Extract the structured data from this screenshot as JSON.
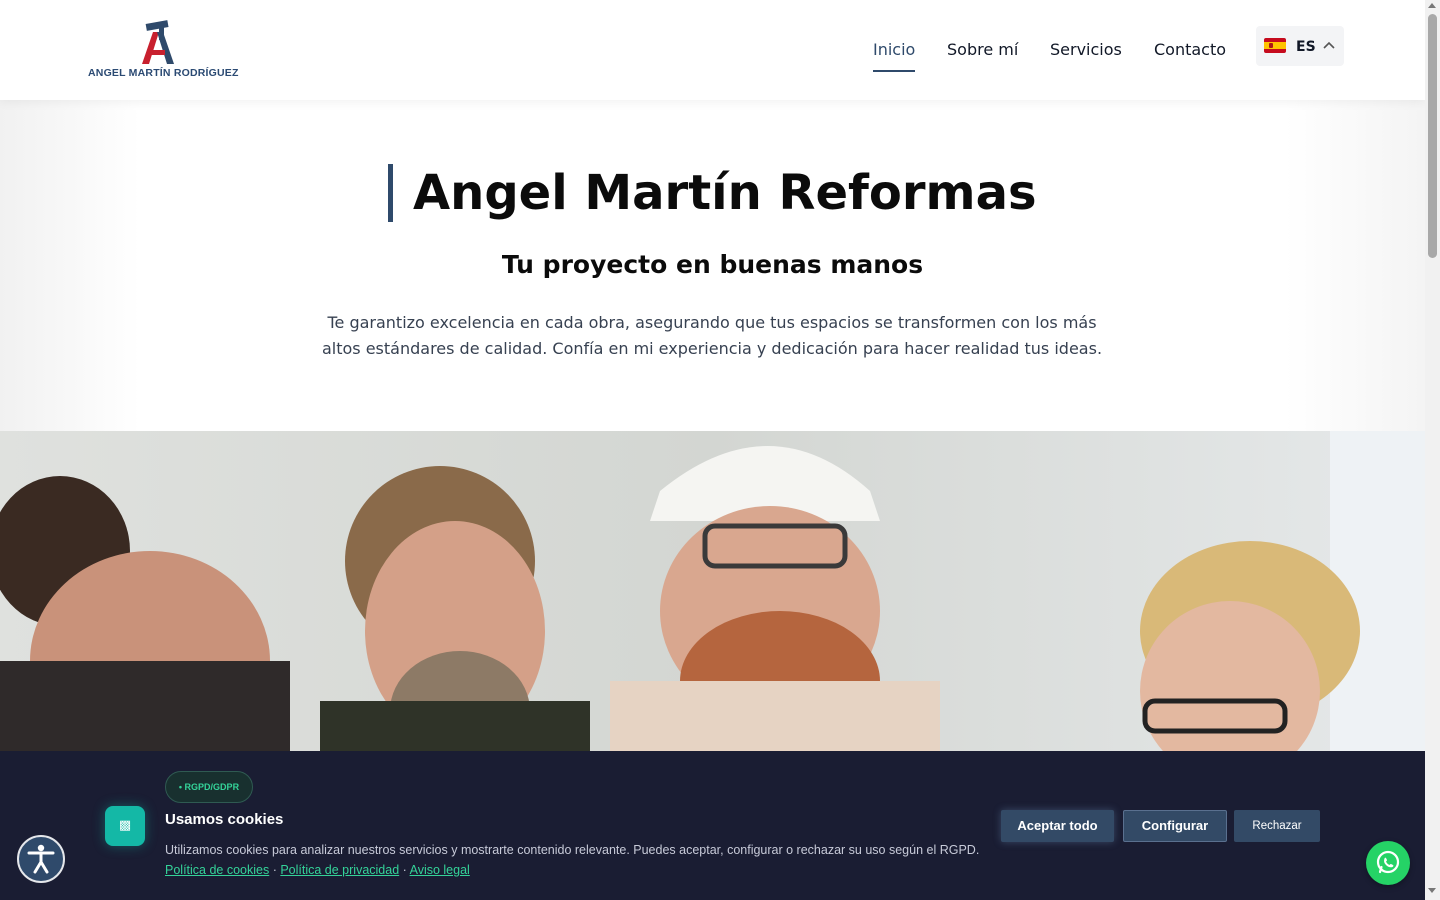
{
  "brand": {
    "logo_text": "ANGEL MARTÍN RODRÍGUEZ",
    "logo_icon": "hammer-a-logo-icon",
    "colors": {
      "navy": "#2f4a6b",
      "red": "#c8202e",
      "banner_bg": "#1a1d33",
      "accent_green": "#34d399"
    }
  },
  "nav": {
    "items": [
      {
        "label": "Inicio",
        "active": true
      },
      {
        "label": "Sobre mí",
        "active": false
      },
      {
        "label": "Servicios",
        "active": false
      },
      {
        "label": "Contacto",
        "active": false
      }
    ],
    "language": {
      "code": "ES",
      "flag": "spain-flag-icon",
      "chevron": "chevron-up-icon"
    }
  },
  "hero": {
    "title": "Angel Martín Reformas",
    "subtitle": "Tu proyecto en buenas manos",
    "description": "Te garantizo excelencia en cada obra, asegurando que tus espacios se transformen con los más altos estándares de calidad. Confía en mi experiencia y dedicación para hacer realidad tus ideas.",
    "image_icon": "team-construction-photo"
  },
  "cookie_banner": {
    "badge": "• RGPD/GDPR",
    "icon": "cookie-icon",
    "title": "Usamos cookies",
    "text": "Utilizamos cookies para analizar nuestros servicios y mostrarte contenido relevante. Puedes aceptar, configurar o rechazar su uso según el RGPD.",
    "links": [
      "Política de cookies",
      "Política de privacidad",
      "Aviso legal"
    ],
    "separator": " · ",
    "buttons": {
      "accept": "Aceptar todo",
      "configure": "Configurar",
      "reject": "Rechazar"
    }
  },
  "floating": {
    "accessibility_icon": "accessibility-icon",
    "whatsapp_icon": "whatsapp-icon"
  }
}
